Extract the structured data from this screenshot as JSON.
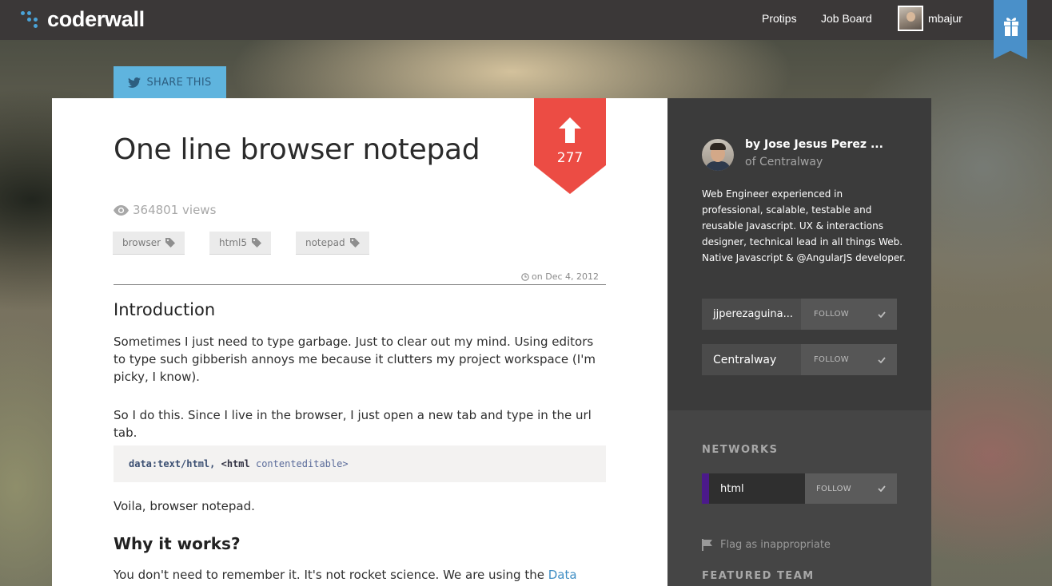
{
  "header": {
    "logo_text": "coderwall",
    "nav": {
      "protips": "Protips",
      "job_board": "Job Board"
    },
    "user": {
      "name": "mbajur"
    },
    "gift_icon": "gift-icon"
  },
  "share": {
    "label": "SHARE THIS",
    "icon": "twitter-bird-icon"
  },
  "article": {
    "title": "One line browser notepad",
    "upvotes": "277",
    "views": "364801 views",
    "tags": [
      "browser",
      "html5",
      "notepad"
    ],
    "date": "on Dec 4, 2012",
    "intro_heading": "Introduction",
    "intro_p1": "Sometimes I just need to type garbage. Just to clear out my mind. Using editors to type such gibberish annoys me because it clutters my project workspace (I'm picky, I know).",
    "intro_p2": "So I do this. Since I live in the browser, I just open a new tab and type in the url tab.",
    "code": {
      "kw": "data:text/html,",
      "tag": "<html",
      "attr": "contenteditable>"
    },
    "voila": "Voila, browser notepad.",
    "why_heading": "Why it works?",
    "why_p_start": "You don't need to remember it. It's not rocket science. We are using the ",
    "why_link": "Data URI's"
  },
  "sidebar": {
    "author_name": "by Jose Jesus Perez ...",
    "author_org": "of Centralway",
    "bio": "Web Engineer experienced in professional, scalable, testable and reusable Javascript. UX & interactions designer, technical lead in all things Web. Native Javascript & @AngularJS developer.",
    "follows": [
      {
        "name": "jjperezaguina...",
        "button": "FOLLOW"
      },
      {
        "name": "Centralway",
        "button": "FOLLOW"
      }
    ],
    "networks_title": "NETWORKS",
    "network": {
      "name": "html",
      "button": "FOLLOW",
      "accent": "#4b1a8a"
    },
    "flag_label": "Flag as inappropriate",
    "featured_team_title": "FEATURED TEAM"
  },
  "colors": {
    "topbar": "#3b3838",
    "brand_blue": "#4a90c9",
    "share_blue": "#5fb4de",
    "upvote_red": "#ec4c44",
    "sidebar_dark": "#3b3b3b"
  }
}
